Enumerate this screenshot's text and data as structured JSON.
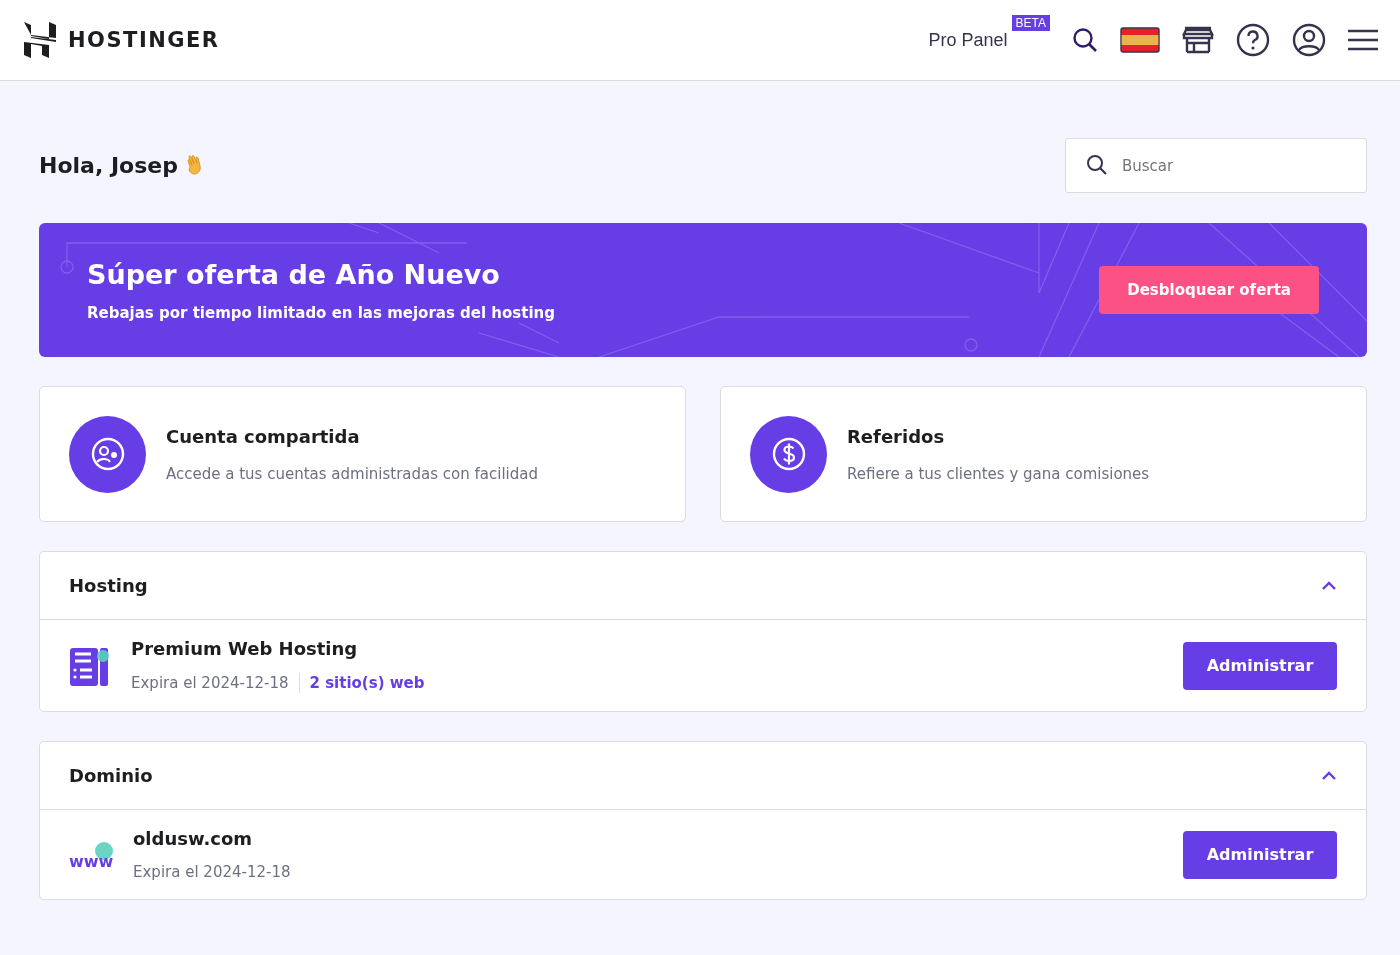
{
  "header": {
    "logo": "HOSTINGER",
    "pro_panel": "Pro Panel",
    "badge": "BETA"
  },
  "greeting": "Hola, Josep",
  "search": {
    "placeholder": "Buscar"
  },
  "promo": {
    "title": "Súper oferta de Año Nuevo",
    "subtitle": "Rebajas por tiempo limitado en las mejoras del hosting",
    "button": "Desbloquear oferta"
  },
  "cards": [
    {
      "kind": "account",
      "title": "Cuenta compartida",
      "description": "Accede a tus cuentas administradas con facilidad"
    },
    {
      "kind": "referral",
      "title": "Referidos",
      "description": "Refiere a tus clientes y gana comisiones"
    }
  ],
  "sections": [
    {
      "title": "Hosting",
      "expanded": true,
      "item": {
        "kind": "hosting",
        "name": "Premium Web Hosting",
        "expires": "Expira el 2024-12-18",
        "link": "2 sitio(s) web",
        "button": "Administrar"
      }
    },
    {
      "title": "Dominio",
      "expanded": true,
      "item": {
        "kind": "domain",
        "icon_text": "www",
        "name": "oldusw.com",
        "expires": "Expira el 2024-12-18",
        "button": "Administrar"
      }
    }
  ]
}
